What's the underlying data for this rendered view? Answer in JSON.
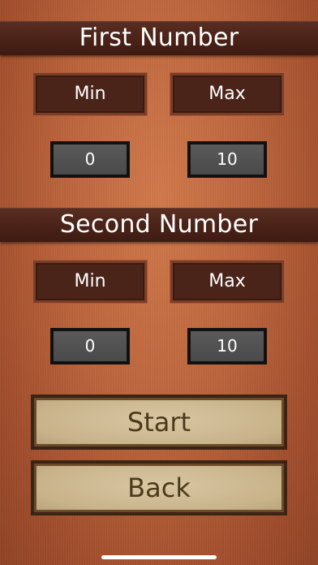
{
  "first_number": {
    "title": "First Number",
    "min_label": "Min",
    "max_label": "Max",
    "min_value": "0",
    "max_value": "10"
  },
  "second_number": {
    "title": "Second Number",
    "min_label": "Min",
    "max_label": "Max",
    "min_value": "0",
    "max_value": "10"
  },
  "actions": {
    "start_label": "Start",
    "back_label": "Back"
  },
  "colors": {
    "wood_background": "#b9623a",
    "banner": "#4a2218",
    "label_box": "#4a2419",
    "value_field": "#4f4f4f",
    "button_face": "#c8b38a",
    "button_text": "#4b3a1a"
  }
}
